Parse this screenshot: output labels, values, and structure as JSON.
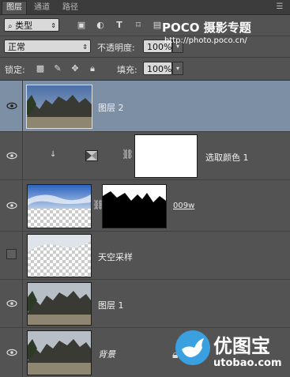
{
  "tabs": [
    {
      "label": "图层",
      "active": true
    },
    {
      "label": "通道",
      "active": false
    },
    {
      "label": "路径",
      "active": false
    }
  ],
  "filter": {
    "label": "类型",
    "icons": [
      "image-filter-icon",
      "adjustment-filter-icon",
      "type-filter-icon",
      "shape-filter-icon",
      "smart-object-filter-icon"
    ]
  },
  "blend": {
    "mode": "正常",
    "opacity_label": "不透明度:",
    "opacity_value": "100%"
  },
  "lock": {
    "label": "锁定:",
    "fill_label": "填充:",
    "fill_value": "100%"
  },
  "layers": [
    {
      "name": "图层 2",
      "visible": true,
      "selected": true
    },
    {
      "name": "选取颜色 1",
      "visible": true,
      "selected": false
    },
    {
      "name": "009w",
      "visible": true,
      "selected": false
    },
    {
      "name": "天空采样",
      "visible": false,
      "selected": false
    },
    {
      "name": "图层 1",
      "visible": true,
      "selected": false
    },
    {
      "name": "背景",
      "visible": true,
      "selected": false
    }
  ],
  "watermark_top": {
    "brand": "POCO 摄影专题",
    "url": "http://photo.poco.cn/"
  },
  "watermark_bottom": {
    "brand": "优图宝",
    "url": "utobao.com"
  },
  "colors": {
    "panel": "#535353",
    "selected_row": "#7d8fa5",
    "tabbar": "#3c3c3c"
  }
}
